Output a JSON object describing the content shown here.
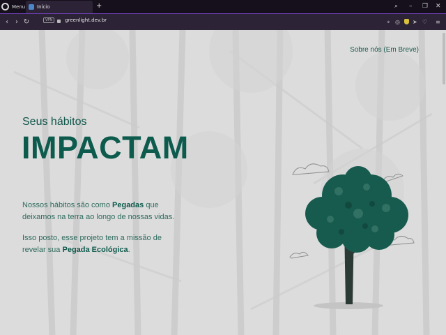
{
  "browser": {
    "menu_label": "Menu",
    "tab_title": "Início",
    "new_tab": "+",
    "url": "greenlight.dev.br",
    "vpn_label": "VPN"
  },
  "page": {
    "nav_link": "Sobre nós (Em Breve)",
    "kicker": "Seus hábitos",
    "headline": "IMPACTAM",
    "para1": {
      "text_before": "Nossos hábitos são como ",
      "highlight": "Pegadas",
      "text_after": " que deixamos na terra ao longo de nossas vidas."
    },
    "para2": {
      "text_before": "Isso posto, esse projeto tem a missão de revelar sua ",
      "highlight": "Pegada Ecológica",
      "text_after": "."
    }
  },
  "colors": {
    "brand_green": "#0d5b4d",
    "tree_green": "#175a4e",
    "page_bg": "#dcdcdc",
    "chrome_bg": "#2c2336"
  }
}
